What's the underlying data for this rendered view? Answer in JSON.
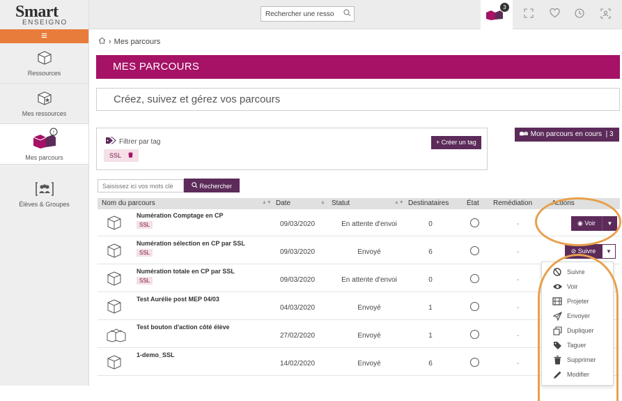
{
  "app": {
    "brand": "Smart",
    "brand_sub": "ENSEIGNO"
  },
  "topbar": {
    "search_value": "Rechercher une resso",
    "cart_count": "3"
  },
  "sidebar": {
    "items": [
      {
        "label": "Ressources",
        "icon": "cube-icon"
      },
      {
        "label": "Mes ressources",
        "icon": "cube-star-icon"
      },
      {
        "label": "Mes parcours",
        "icon": "parcours-icon"
      },
      {
        "label": "Élèves & Groupes",
        "icon": "students-icon"
      }
    ]
  },
  "breadcrumb": {
    "current": "Mes parcours"
  },
  "banner": {
    "title": "MES PARCOURS"
  },
  "subtitle": "Créez, suivez et gérez vos parcours",
  "filter": {
    "label": "Filtrer par tag",
    "tag": "SSL",
    "create_label": "Créer un tag"
  },
  "mon_parcours": {
    "label": "Mon parcours en cours",
    "count": "3"
  },
  "search": {
    "placeholder": "Saisissez ici vos mots clé",
    "button": "Rechercher"
  },
  "table": {
    "headers": [
      "Nom du parcours",
      "Date",
      "Statut",
      "Destinataires",
      "État",
      "Remédiation",
      "Actions"
    ],
    "rows": [
      {
        "name": "Numération Comptage en CP",
        "tag": "SSL",
        "date": "09/03/2020",
        "statut": "En attente d'envoi",
        "dest": "0",
        "remed": "-"
      },
      {
        "name": "Numération sélection en CP par SSL",
        "tag": "SSL",
        "date": "09/03/2020",
        "statut": "Envoyé",
        "dest": "6",
        "remed": "-"
      },
      {
        "name": "Numération totale en CP par SSL",
        "tag": "SSL",
        "date": "09/03/2020",
        "statut": "En attente d'envoi",
        "dest": "0",
        "remed": "-"
      },
      {
        "name": "Test Aurélie post MEP 04/03",
        "tag": "",
        "date": "04/03/2020",
        "statut": "Envoyé",
        "dest": "1",
        "remed": "-"
      },
      {
        "name": "Test bouton d'action côté élève",
        "tag": "",
        "date": "27/02/2020",
        "statut": "Envoyé",
        "dest": "1",
        "remed": "-"
      },
      {
        "name": "1-demo_SSL",
        "tag": "",
        "date": "14/02/2020",
        "statut": "Envoyé",
        "dest": "6",
        "remed": "-"
      }
    ],
    "voir_label": "Voir",
    "suivre_label": "Suivre"
  },
  "dropdown": {
    "items": [
      {
        "label": "Suivre",
        "icon": "eye-slash-icon"
      },
      {
        "label": "Voir",
        "icon": "eye-icon"
      },
      {
        "label": "Projeter",
        "icon": "film-icon"
      },
      {
        "label": "Envoyer",
        "icon": "send-icon"
      },
      {
        "label": "Dupliquer",
        "icon": "copy-icon"
      },
      {
        "label": "Taguer",
        "icon": "tag-icon"
      },
      {
        "label": "Supprimer",
        "icon": "trash-icon"
      },
      {
        "label": "Modifier",
        "icon": "pencil-icon"
      }
    ]
  },
  "colors": {
    "accent": "#a51266",
    "button": "#5c2b5a",
    "orange": "#e87c3a",
    "highlight": "#e8a04c"
  }
}
